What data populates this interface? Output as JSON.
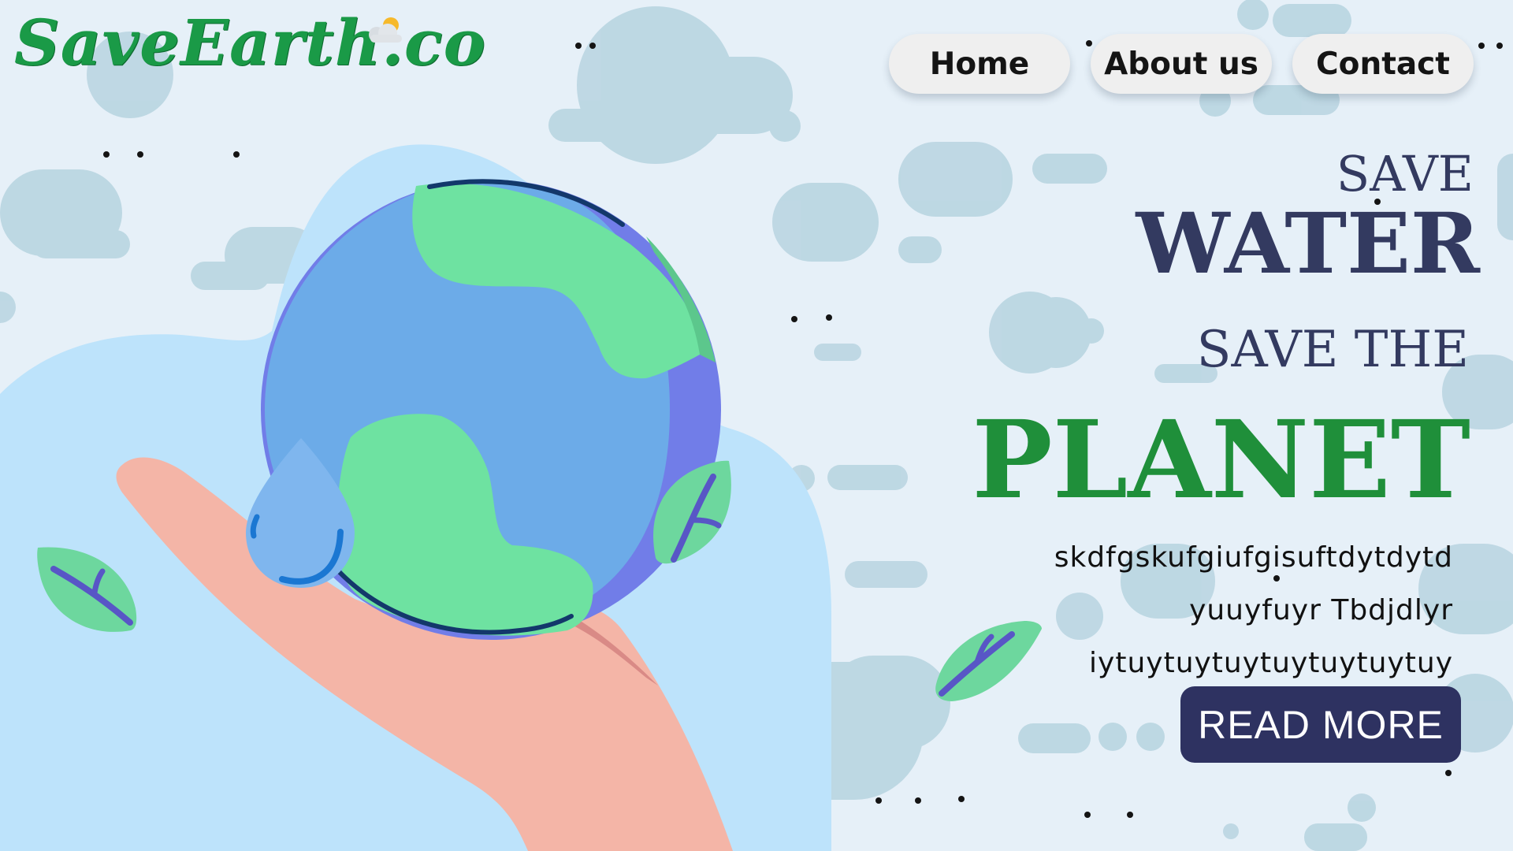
{
  "brand": {
    "logo_text": "SaveEarth.co"
  },
  "nav": {
    "items": [
      "Home",
      "About us",
      "Contact"
    ]
  },
  "hero": {
    "line1": "SAVE",
    "line2": "WATER",
    "line3": "SAVE THE",
    "line4": "PLANET",
    "paragraph": [
      "skdfgskufgiufgisuftdytdytd",
      "yuuyfuyr Tbdjdlyr",
      "iytuytuytuytuytuytuytuy"
    ],
    "cta_label": "READ MORE"
  },
  "colors": {
    "background": "#e6f0f8",
    "brand_green": "#1a9a47",
    "heading_navy": "#333a60",
    "planet_green": "#1f8f3a",
    "button_bg": "#2e3261",
    "nav_bg": "#efefef"
  },
  "icons": [
    "weather-cloud-sun-icon",
    "leaf-icon",
    "water-drop-icon",
    "earth-globe-icon",
    "hand-illustration"
  ]
}
